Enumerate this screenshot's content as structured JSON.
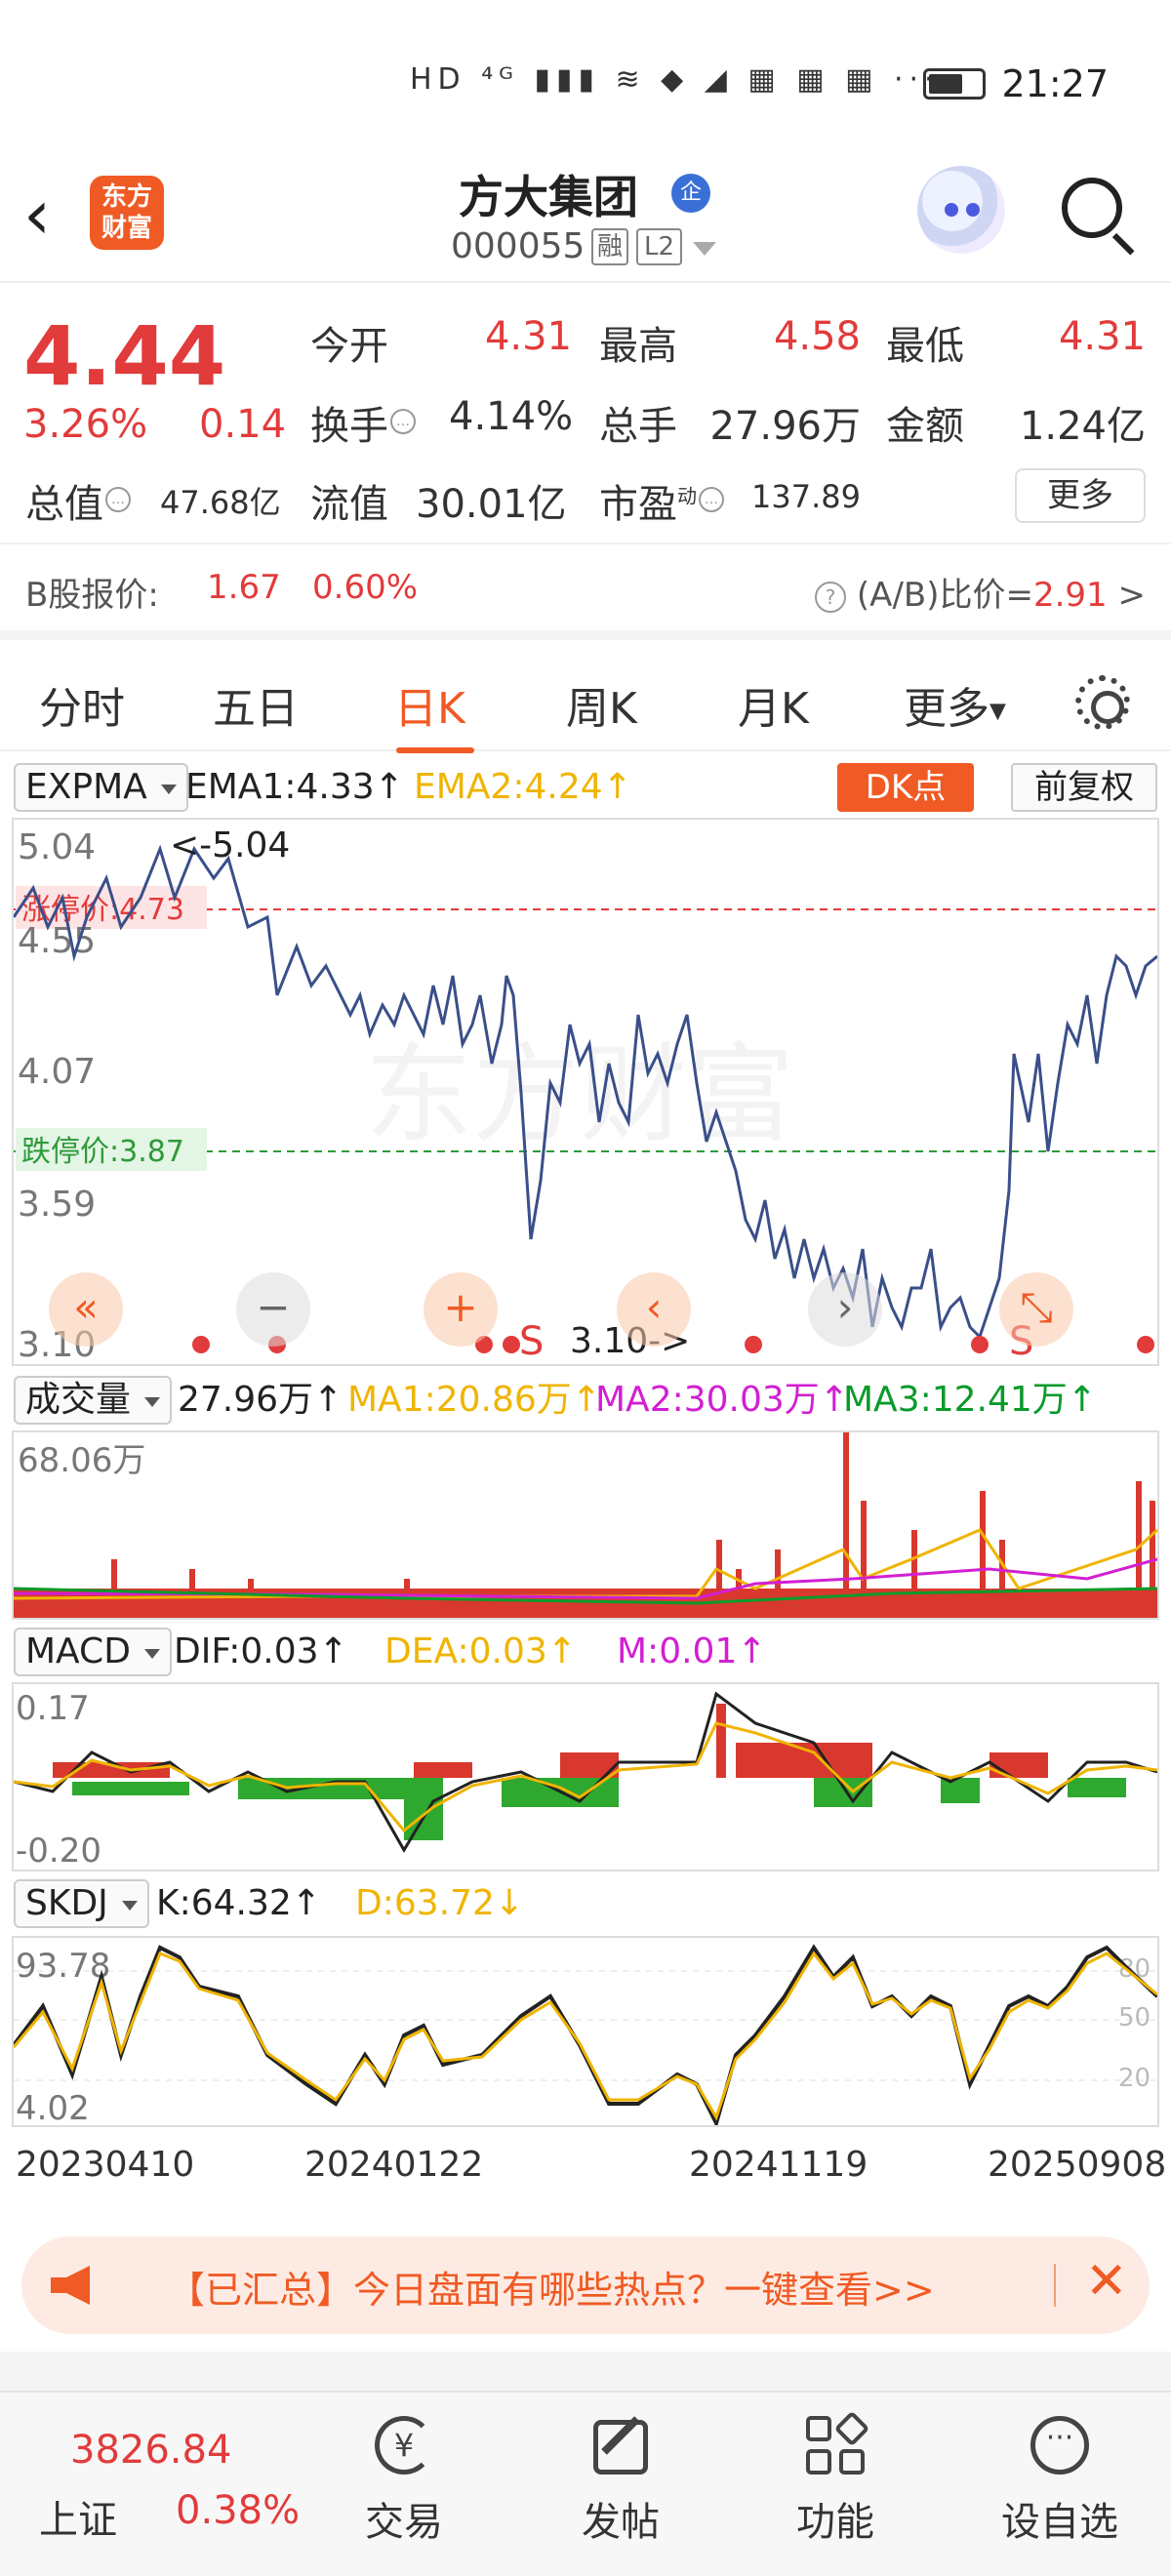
{
  "status_bar": {
    "time": "21:27",
    "indicators": "HD ⁴ᴳ ▮▮▮ ≋ ◆ ◢ ▦ ▦ ▦ ···"
  },
  "header": {
    "back_icon": "chevron-left-icon",
    "logo_text_line1": "东方",
    "logo_text_line2": "财富",
    "stock_name": "方大集团",
    "enterprise_badge": "企",
    "stock_code": "000055",
    "rong_badge": "融",
    "level_badge": "L2"
  },
  "quote": {
    "price": "4.44",
    "change_pct": "3.26%",
    "change_amt": "0.14",
    "open_label": "今开",
    "open": "4.31",
    "high_label": "最高",
    "high": "4.58",
    "low_label": "最低",
    "low": "4.31",
    "turnover_label": "换手",
    "turnover": "4.14%",
    "volume_label": "总手",
    "volume": "27.96万",
    "amount_label": "金额",
    "amount": "1.24亿",
    "mktcap_label": "总值",
    "mktcap": "47.68亿",
    "float_label": "流值",
    "float_cap": "30.01亿",
    "pe_label": "市盈",
    "pe_sup": "动",
    "pe": "137.89",
    "more_button": "更多"
  },
  "b_share": {
    "label": "B股报价:",
    "price": "1.67",
    "pct": "0.60%",
    "ratio_label": "(A/B)比价=",
    "ratio": "2.91",
    "arrow": ">"
  },
  "period_tabs": [
    "分时",
    "五日",
    "日K",
    "周K",
    "月K",
    "更多"
  ],
  "active_tab": "日K",
  "main_indicator": {
    "name": "EXPMA",
    "ema1": "EMA1:4.33↑",
    "ema2": "EMA2:4.24↑",
    "dk_button": "DK点",
    "adjust_button": "前复权",
    "y_ticks": [
      "5.04",
      "4.55",
      "4.07",
      "3.59",
      "3.10"
    ],
    "max_label": "<-5.04",
    "min_label": "3.10->",
    "limit_up_label": "涨停价:4.73",
    "limit_down_label": "跌停价:3.87",
    "watermark": "东方财富",
    "colors": {
      "price_line": "#3a4f8a",
      "limit_up": "#e23b3b",
      "limit_down": "#2e9a3a"
    }
  },
  "chart_controls": [
    "«",
    "−",
    "+",
    "‹",
    "›",
    "⤡"
  ],
  "volume_indicator": {
    "name": "成交量",
    "value": "27.96万↑",
    "ma1": "MA1:20.86万↑",
    "ma2": "MA2:30.03万↑",
    "ma3": "MA3:12.41万↑",
    "max_label": "68.06万"
  },
  "macd_indicator": {
    "name": "MACD",
    "dif": "DIF:0.03↑",
    "dea": "DEA:0.03↑",
    "m": "M:0.01↑",
    "y_top": "0.17",
    "y_bottom": "-0.20"
  },
  "skdj_indicator": {
    "name": "SKDJ",
    "k": "K:64.32↑",
    "d": "D:63.72↓",
    "y_top": "93.78",
    "y_bottom": "4.02",
    "right_ticks": [
      "80",
      "50",
      "20"
    ]
  },
  "x_dates": [
    "20230410",
    "20240122",
    "20241119",
    "20250908"
  ],
  "banner": {
    "text": "【已汇总】今日盘面有哪些热点？一键查看>>",
    "close": "✕"
  },
  "bottom_nav": {
    "index_value": "3826.84",
    "index_name": "上证",
    "index_pct": "0.38%",
    "items": [
      {
        "label": "交易",
        "icon": "yuan-refresh-icon"
      },
      {
        "label": "发帖",
        "icon": "edit-icon"
      },
      {
        "label": "功能",
        "icon": "apps-grid-icon"
      },
      {
        "label": "设自选",
        "icon": "more-dots-icon"
      }
    ]
  }
}
